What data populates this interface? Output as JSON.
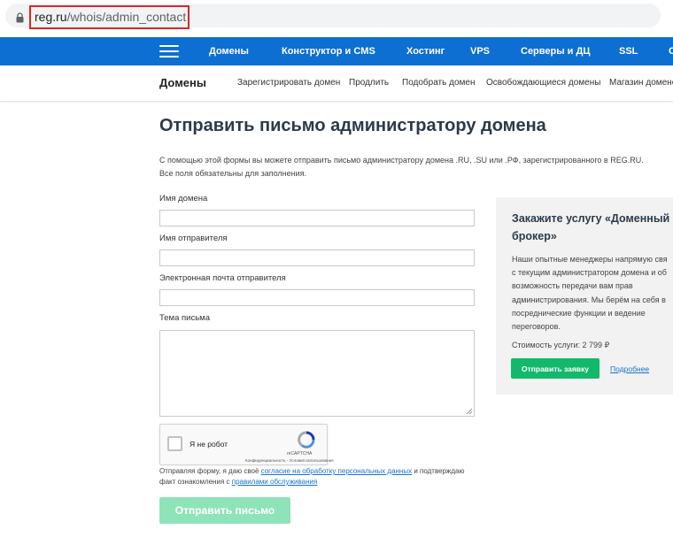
{
  "address_bar": {
    "host": "reg.ru",
    "path": "/whois/admin_contact"
  },
  "top_nav": {
    "items": [
      {
        "label": "Домены"
      },
      {
        "label": "Конструктор и CMS"
      },
      {
        "label": "Хостинг"
      },
      {
        "label": "VPS"
      },
      {
        "label": "Серверы и ДЦ"
      },
      {
        "label": "SSL"
      },
      {
        "label": "С"
      }
    ]
  },
  "sub_nav": {
    "title": "Домены",
    "items": [
      {
        "label": "Зарегистрировать домен"
      },
      {
        "label": "Продлить"
      },
      {
        "label": "Подобрать домен"
      },
      {
        "label": "Освобождающиеся домены"
      },
      {
        "label": "Магазин доменов"
      }
    ]
  },
  "main": {
    "title": "Отправить письмо администратору домена",
    "intro_line1": "С помощью этой формы вы можете отправить письмо администратору домена .RU, .SU или .РФ, зарегистрированного в REG.RU.",
    "intro_line2": "Все поля обязательны для заполнения.",
    "fields": {
      "domain_label": "Имя домена",
      "domain_value": "",
      "sender_label": "Имя отправителя",
      "sender_value": "",
      "email_label": "Электронная почта отправителя",
      "email_value": "",
      "subject_label": "Тема письма",
      "subject_value": ""
    },
    "captcha": {
      "label": "Я не робот",
      "brand": "reCAPTCHA",
      "links": "Конфиденциальность - Условия использования"
    },
    "consent": {
      "prefix": "Отправляя форму, я даю своё ",
      "link1": "согласие на обработку персональных данных",
      "middle": " и подтверждаю факт ознакомления с ",
      "link2": "правилами обслуживания"
    },
    "submit_label": "Отправить письмо"
  },
  "promo": {
    "title": "Закажите услугу «Доменный\nброкер»",
    "text": "Наши опытные менеджеры напрямую свя\nс текущим администратором домена и об\nвозможность передачи вам прав\nадминистрирования. Мы берём на себя в\nпосреднические функции и ведение\nпереговоров.",
    "price": "Стоимость услуги: 2 799 ₽",
    "button_label": "Отправить заявку",
    "more_label": "Подробнее"
  },
  "colors": {
    "nav_blue": "#0d6fd1",
    "submit_green_disabled": "#8fe3b8",
    "promo_green": "#12b96a",
    "url_highlight": "#d9262a"
  }
}
